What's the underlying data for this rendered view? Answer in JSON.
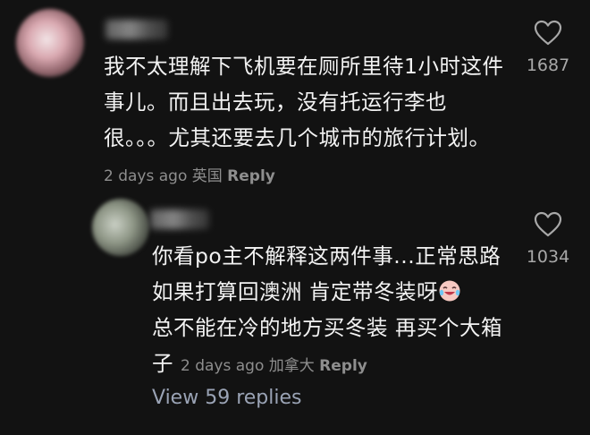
{
  "comments": [
    {
      "text": "我不太理解下飞机要在厕所里待1小时这件事儿。而且出去玩，没有托运行李也很。。。尤其还要去几个城市的旅行计划。",
      "time": "2 days ago",
      "location": "英国",
      "reply_label": "Reply",
      "like_count": "1687"
    },
    {
      "text": "你看po主不解释这两件事...正常思路如果打算回澳洲 肯定带冬装呀",
      "text_after_emoji": "总不能在冷的地方买冬装 再买个大箱子",
      "emoji": "crying-laughing-face",
      "time": "2 days ago",
      "location": "加拿大",
      "reply_label": "Reply",
      "like_count": "1034"
    }
  ],
  "view_replies_label": "View 59 replies",
  "colors": {
    "background": "#121212",
    "text": "#f2f2f2",
    "meta": "#8e8e8e",
    "view_replies": "#9aa3b5"
  }
}
